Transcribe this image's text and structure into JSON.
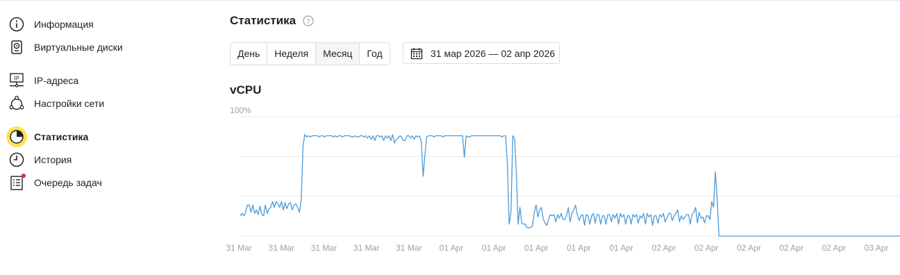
{
  "sidebar": {
    "items": [
      {
        "label": "Информация",
        "icon": "info-icon"
      },
      {
        "label": "Виртуальные диски",
        "icon": "disk-icon"
      },
      {
        "label": "IP-адреса",
        "icon": "ip-icon"
      },
      {
        "label": "Настройки сети",
        "icon": "network-icon"
      },
      {
        "label": "Статистика",
        "icon": "pie-chart-icon",
        "active": true
      },
      {
        "label": "История",
        "icon": "clock-icon"
      },
      {
        "label": "Очередь задач",
        "icon": "task-list-icon",
        "badge": true
      }
    ]
  },
  "main": {
    "title": "Статистика",
    "help_icon": "question-icon",
    "periods": [
      "День",
      "Неделя",
      "Месяц",
      "Год"
    ],
    "selected_period": "Месяц",
    "date_range": "31 мар 2026 — 02 апр 2026",
    "calendar_icon": "calendar-icon"
  },
  "colors": {
    "accent": "#fde458",
    "line": "#4a9ad8",
    "grid": "#e6e8eb",
    "badge": "#e0245e"
  },
  "chart_data": {
    "type": "line",
    "title": "vCPU",
    "ylabel": "",
    "xlabel": "",
    "y_max_label": "100%",
    "ylim": [
      0,
      100
    ],
    "grid": true,
    "x_tick_labels": [
      "31 Mar",
      "31 Mar",
      "31 Mar",
      "31 Mar",
      "31 Mar",
      "01 Apr",
      "01 Apr",
      "01 Apr",
      "01 Apr",
      "01 Apr",
      "02 Apr",
      "02 Apr",
      "02 Apr",
      "02 Apr",
      "02 Apr",
      "03 Apr"
    ],
    "series": [
      {
        "values": [
          17,
          19,
          17,
          20,
          26,
          26,
          20,
          26,
          19,
          22,
          18,
          25,
          18,
          17,
          26,
          19,
          23,
          24,
          29,
          24,
          29,
          27,
          24,
          29,
          22,
          28,
          23,
          27,
          28,
          22,
          26,
          27,
          24,
          20,
          30,
          76,
          85,
          83,
          84,
          83,
          84,
          84,
          84,
          84,
          83,
          84,
          84,
          83,
          84,
          84,
          84,
          84,
          83,
          84,
          83,
          84,
          84,
          83,
          84,
          84,
          84,
          84,
          83,
          83,
          84,
          83,
          83,
          84,
          84,
          83,
          84,
          82,
          84,
          81,
          84,
          80,
          84,
          84,
          83,
          84,
          80,
          84,
          82,
          84,
          80,
          85,
          78,
          81,
          82,
          84,
          83,
          80,
          80,
          84,
          84,
          82,
          84,
          81,
          84,
          83,
          84,
          79,
          50,
          68,
          83,
          84,
          84,
          84,
          83,
          84,
          84,
          84,
          84,
          83,
          84,
          84,
          84,
          84,
          84,
          84,
          84,
          84,
          84,
          84,
          84,
          66,
          84,
          83,
          83,
          84,
          84,
          84,
          84,
          84,
          84,
          84,
          84,
          84,
          84,
          84,
          84,
          84,
          84,
          84,
          84,
          84,
          83,
          84,
          84,
          61,
          10,
          20,
          84,
          82,
          52,
          10,
          24,
          11,
          10,
          10,
          7,
          7,
          7,
          9,
          20,
          26,
          16,
          22,
          24,
          14,
          11,
          9,
          14,
          18,
          17,
          18,
          12,
          18,
          15,
          19,
          14,
          14,
          17,
          24,
          12,
          19,
          22,
          26,
          18,
          13,
          17,
          18,
          9,
          18,
          17,
          10,
          17,
          19,
          11,
          18,
          18,
          10,
          17,
          17,
          10,
          18,
          18,
          12,
          18,
          15,
          19,
          10,
          19,
          16,
          18,
          10,
          17,
          17,
          10,
          18,
          16,
          18,
          11,
          17,
          15,
          19,
          10,
          19,
          16,
          18,
          9,
          17,
          17,
          11,
          18,
          16,
          19,
          12,
          15,
          19,
          19,
          13,
          17,
          19,
          22,
          12,
          17,
          14,
          16,
          18,
          18,
          10,
          18,
          20,
          24,
          11,
          20,
          15,
          16,
          11,
          17,
          17,
          14,
          29,
          24,
          54,
          31,
          0,
          0,
          0,
          0,
          0,
          0,
          0,
          0,
          0,
          0,
          0,
          0,
          0,
          0,
          0,
          0,
          0,
          0,
          0,
          0,
          0,
          0,
          0,
          0,
          0,
          0,
          0,
          0,
          0,
          0,
          0,
          0,
          0,
          0,
          0,
          0,
          0,
          0,
          0,
          0,
          0,
          0,
          0,
          0,
          0,
          0,
          0,
          0,
          0,
          0,
          0,
          0,
          0,
          0,
          0,
          0,
          0,
          0,
          0,
          0,
          0,
          0,
          0,
          0,
          0,
          0,
          0,
          0,
          0,
          0,
          0,
          0,
          0,
          0,
          0,
          0,
          0,
          0,
          0,
          0,
          0,
          0,
          0,
          0,
          0,
          0,
          0,
          0,
          0,
          0,
          0,
          0,
          0,
          0,
          0,
          0,
          0,
          0,
          0,
          0,
          0,
          0
        ]
      }
    ]
  }
}
